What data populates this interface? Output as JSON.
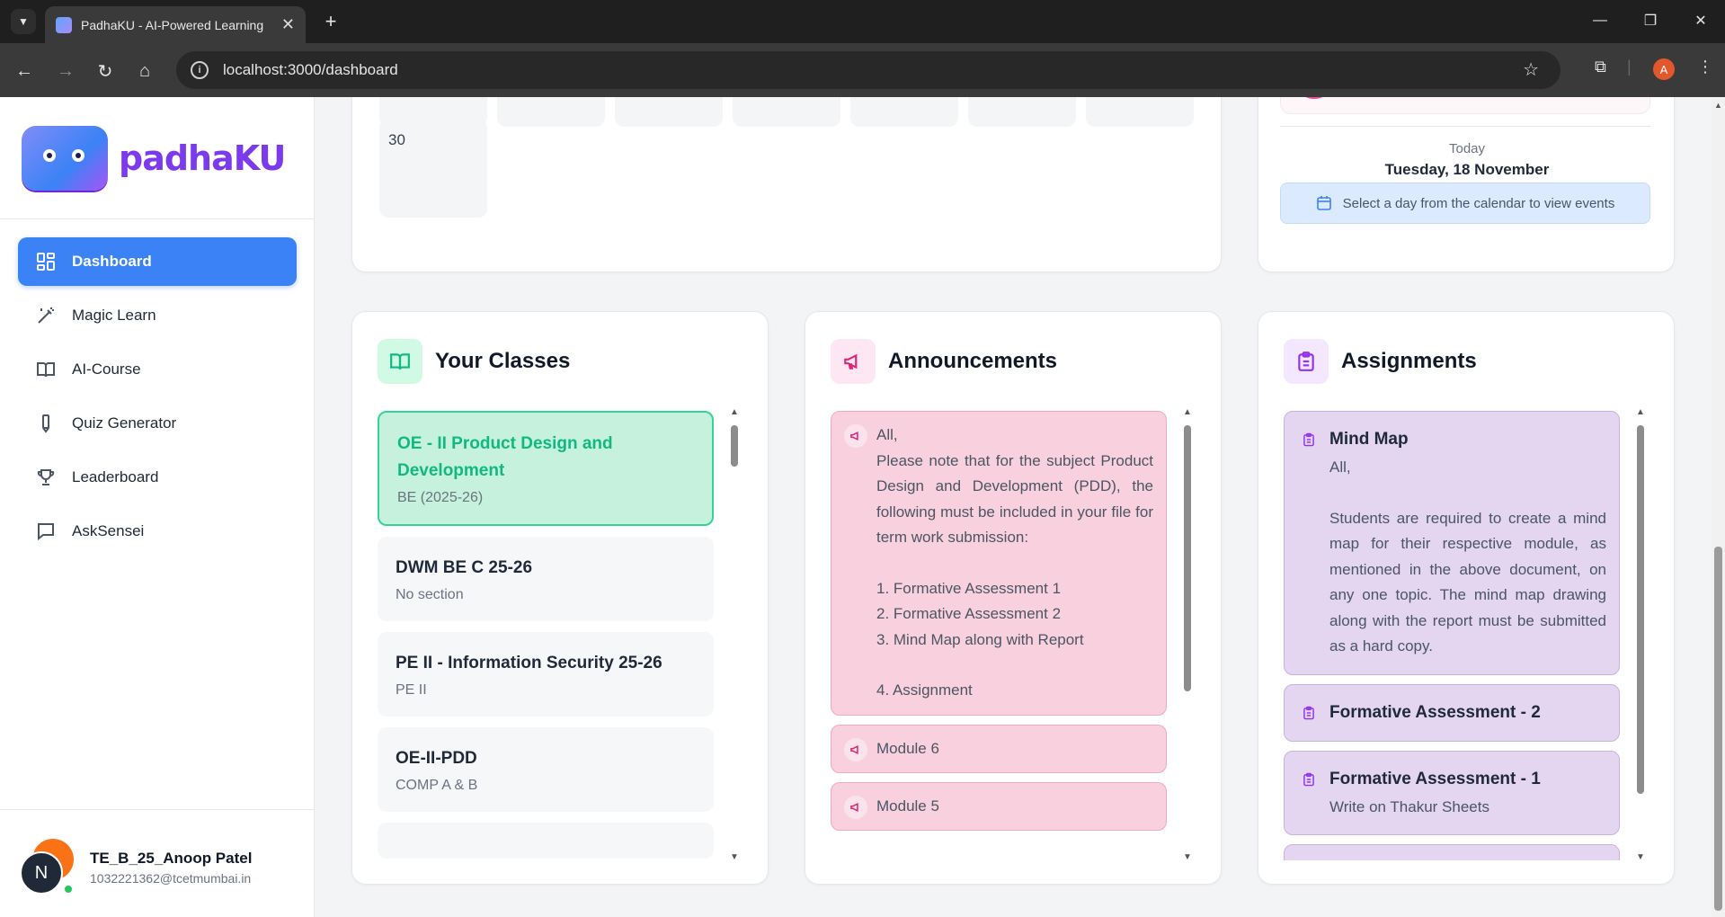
{
  "browser": {
    "tab_title": "PadhaKU - AI-Powered Learning",
    "url": "localhost:3000/dashboard",
    "profile_initial": "A"
  },
  "sidebar": {
    "brand": "padhaKU",
    "items": [
      {
        "label": "Dashboard",
        "icon": "dashboard-icon",
        "active": true
      },
      {
        "label": "Magic Learn",
        "icon": "magic-wand-icon"
      },
      {
        "label": "AI-Course",
        "icon": "book-icon"
      },
      {
        "label": "Quiz Generator",
        "icon": "pen-icon"
      },
      {
        "label": "Leaderboard",
        "icon": "trophy-icon"
      },
      {
        "label": "AskSensei",
        "icon": "chat-icon"
      }
    ],
    "user": {
      "initial": "N",
      "name": "TE_B_25_Anoop Patel",
      "email": "1032221362@tcetmumbai.in"
    }
  },
  "calendar": {
    "last_day": "30"
  },
  "today": {
    "label": "Today",
    "date": "Tuesday, 18 November",
    "hint": "Select a day from the calendar to view events"
  },
  "classes": {
    "title": "Your Classes",
    "items": [
      {
        "name": "OE - II Product Design and Development",
        "section": "BE (2025-26)"
      },
      {
        "name": "DWM BE C 25-26",
        "section": "No section"
      },
      {
        "name": "PE II - Information Security 25-26",
        "section": "PE II"
      },
      {
        "name": "OE-II-PDD",
        "section": "COMP A & B"
      }
    ]
  },
  "announcements": {
    "title": "Announcements",
    "first": {
      "l1": "All,",
      "l2": "Please note that for the subject Product Design and Development (PDD), the following must be included in your file for term work submission:",
      "l3": "1. Formative Assessment 1",
      "l4": "2. Formative Assessment 2",
      "l5": "3. Mind Map along with Report",
      "l6": "4. Assignment"
    },
    "items": [
      "Module 6",
      "Module 5"
    ]
  },
  "assignments": {
    "title": "Assignments",
    "items": [
      {
        "title": "Mind Map",
        "l1": "All,",
        "l2": "Students are required to create a mind map for their respective module, as mentioned in the above document, on any one topic. The mind map drawing along with the report must be submitted as a hard copy."
      },
      {
        "title": "Formative Assessment - 2"
      },
      {
        "title": "Formative Assessment - 1",
        "l1": "Write on Thakur Sheets"
      }
    ]
  },
  "colors": {
    "primary": "#3b82f6",
    "class_selected": "#10b981",
    "announcement": "#db2777",
    "assignment": "#9333ea"
  }
}
